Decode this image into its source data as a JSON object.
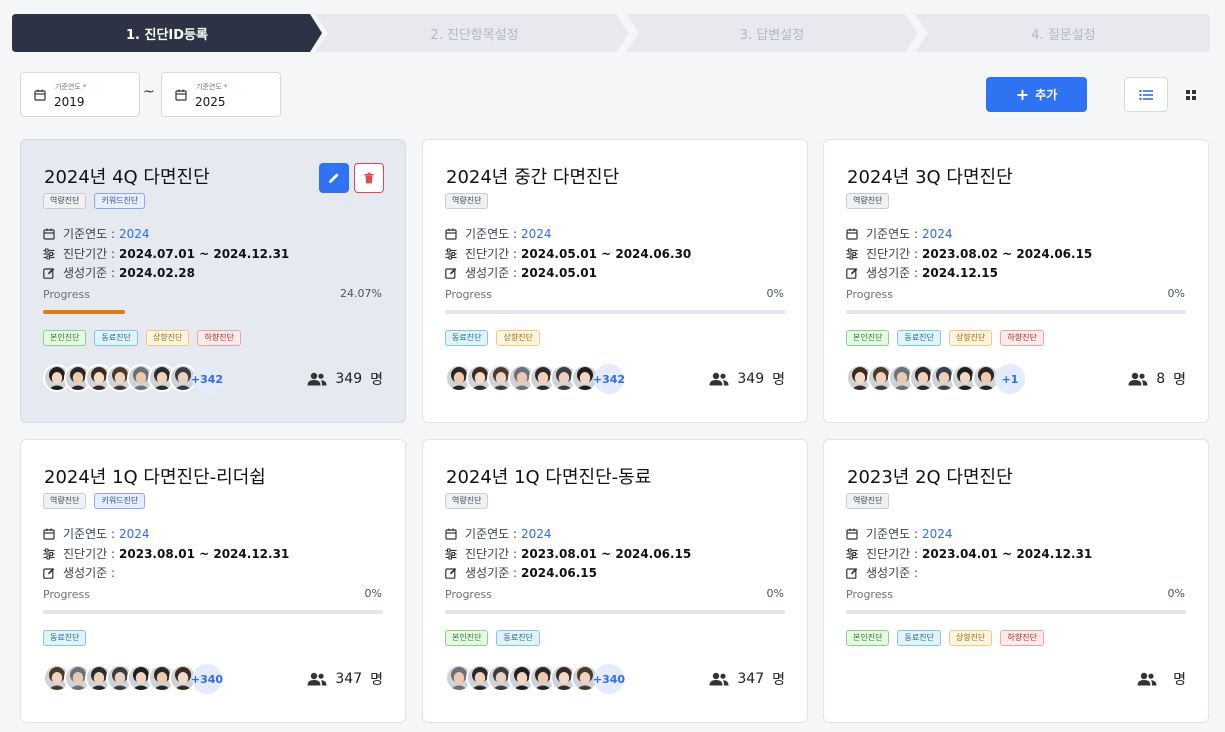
{
  "stepper": {
    "steps": [
      {
        "label": "1. 진단ID등록"
      },
      {
        "label": "2. 진단항목설정"
      },
      {
        "label": "3. 답변설정"
      },
      {
        "label": "4. 질문설정"
      }
    ]
  },
  "filter": {
    "start": {
      "label": "기준연도",
      "value": "2019"
    },
    "end": {
      "label": "기준연도",
      "value": "2025"
    },
    "separator": "~"
  },
  "toolbar": {
    "add_label": "추가",
    "add_icon": "plus-icon",
    "list_icon": "list-view-icon",
    "grid_icon": "grid-view-icon"
  },
  "colors": {
    "accent": "#2f73f2",
    "active_step": "#2d3344",
    "progress": "#e07a12",
    "danger": "#e24a4a"
  },
  "labels": {
    "year": "기준연도 :",
    "period": "진단기간 :",
    "created": "생성기준 :",
    "progress": "Progress",
    "people_unit": "명"
  },
  "cards": [
    {
      "title": "2024년 4Q 다면진단",
      "type_tags": [
        "역량진단",
        "키워드진단"
      ],
      "year": "2024",
      "period": "2024.07.01 ~ 2024.12.31",
      "created": "2024.02.28",
      "progress": "24.07%",
      "progress_value": 0.2407,
      "categories": [
        "본인진단",
        "동료진단",
        "상향진단",
        "하향진단"
      ],
      "avatars_shown": 7,
      "more": "+342",
      "count": "349",
      "selected": true
    },
    {
      "title": "2024년 중간 다면진단",
      "type_tags": [
        "역량진단"
      ],
      "year": "2024",
      "period": "2024.05.01 ~ 2024.06.30",
      "created": "2024.05.01",
      "progress": "0%",
      "progress_value": 0,
      "categories": [
        "동료진단",
        "상향진단"
      ],
      "avatars_shown": 7,
      "more": "+342",
      "count": "349"
    },
    {
      "title": "2024년 3Q 다면진단",
      "type_tags": [
        "역량진단"
      ],
      "year": "2024",
      "period": "2023.08.02 ~ 2024.06.15",
      "created": "2024.12.15",
      "progress": "0%",
      "progress_value": 0,
      "categories": [
        "본인진단",
        "동료진단",
        "상향진단",
        "하향진단"
      ],
      "avatars_shown": 7,
      "more": "+1",
      "count": "8"
    },
    {
      "title": "2024년 1Q 다면진단-리더쉽",
      "type_tags": [
        "역량진단",
        "키워드진단"
      ],
      "year": "2024",
      "period": "2023.08.01 ~ 2024.12.31",
      "created": "",
      "progress": "0%",
      "progress_value": 0,
      "categories": [
        "동료진단"
      ],
      "avatars_shown": 7,
      "more": "+340",
      "count": "347"
    },
    {
      "title": "2024년 1Q 다면진단-동료",
      "type_tags": [
        "역량진단"
      ],
      "year": "2024",
      "period": "2023.08.01 ~ 2024.06.15",
      "created": "2024.06.15",
      "progress": "0%",
      "progress_value": 0,
      "categories": [
        "본인진단",
        "동료진단"
      ],
      "avatars_shown": 7,
      "more": "+340",
      "count": "347"
    },
    {
      "title": "2023년 2Q 다면진단",
      "type_tags": [
        "역량진단"
      ],
      "year": "2024",
      "period": "2023.04.01 ~ 2024.12.31",
      "created": "",
      "progress": "0%",
      "progress_value": 0,
      "categories": [
        "본인진단",
        "동료진단",
        "상향진단",
        "하향진단"
      ],
      "avatars_shown": 0,
      "more": "",
      "count": ""
    }
  ]
}
